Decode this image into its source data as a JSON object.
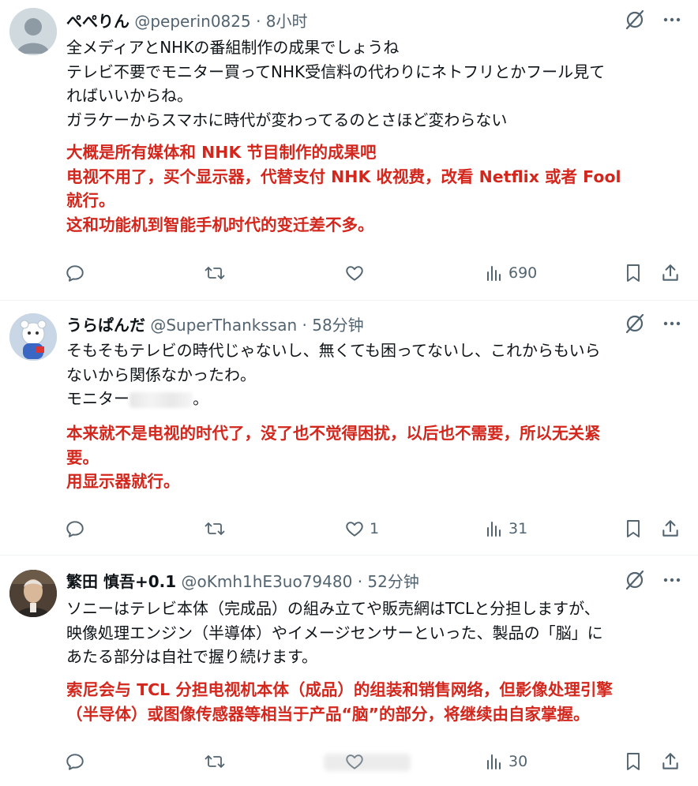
{
  "tweets": [
    {
      "name": "ぺぺりん",
      "handle": "@peperin0825",
      "dot": "·",
      "time": "8小时",
      "jp_lines": [
        "全メディアとNHKの番組制作の成果でしょうね",
        "テレビ不要でモニター買ってNHK受信料の代わりにネトフリとかフール見て",
        "ればいいからね。",
        "ガラケーからスマホに時代が変わってるのとさほど変わらない"
      ],
      "zh_lines": [
        "大概是所有媒体和 NHK 节目制作的成果吧",
        "电视不用了，买个显示器，代替支付 NHK 收视费，改看 Netflix 或者 Fool",
        "就行。",
        "这和功能机到智能手机时代的变迁差不多。"
      ],
      "stats": {
        "replies": "",
        "retweets": "",
        "likes": "",
        "views": "690"
      }
    },
    {
      "name": "うらぱんだ",
      "handle": "@SuperThankssan",
      "dot": "·",
      "time": "58分钟",
      "jp_lines": [
        "そもそもテレビの時代じゃないし、無くても困ってないし、これからもいら",
        "ないから関係なかったわ。",
        "モニター"
      ],
      "jp_line3_suffix": "。",
      "zh_lines": [
        "本来就不是电视的时代了，没了也不觉得困扰，以后也不需要，所以无关紧",
        "要。",
        "用显示器就行。"
      ],
      "stats": {
        "replies": "",
        "retweets": "",
        "likes": "1",
        "views": "31"
      }
    },
    {
      "name": "繁田 慎吾+0.1",
      "handle": "@oKmh1hE3uo79480",
      "dot": "·",
      "time": "52分钟",
      "jp_lines": [
        "ソニーはテレビ本体（完成品）の組み立てや販売網はTCLと分担しますが、",
        "映像処理エンジン（半導体）やイメージセンサーといった、製品の「脳」に",
        "あたる部分は自社で握り続けます。"
      ],
      "zh_lines": [
        "索尼会与 TCL 分担电视机本体（成品）的组装和销售网络，但影像处理引擎",
        "（半导体）或图像传感器等相当于产品“脑”的部分，将继续由自家掌握。"
      ],
      "stats": {
        "replies": "",
        "retweets": "",
        "likes": "",
        "views": "30"
      }
    }
  ],
  "icons": {
    "grok": "grok-icon",
    "more": "more-icon",
    "reply": "reply-icon",
    "retweet": "retweet-icon",
    "like": "like-icon",
    "views": "views-icon",
    "bookmark": "bookmark-icon",
    "share": "share-icon"
  },
  "colors": {
    "translation": "#d3271d",
    "secondary": "#536471",
    "divider": "#eff3f4"
  }
}
